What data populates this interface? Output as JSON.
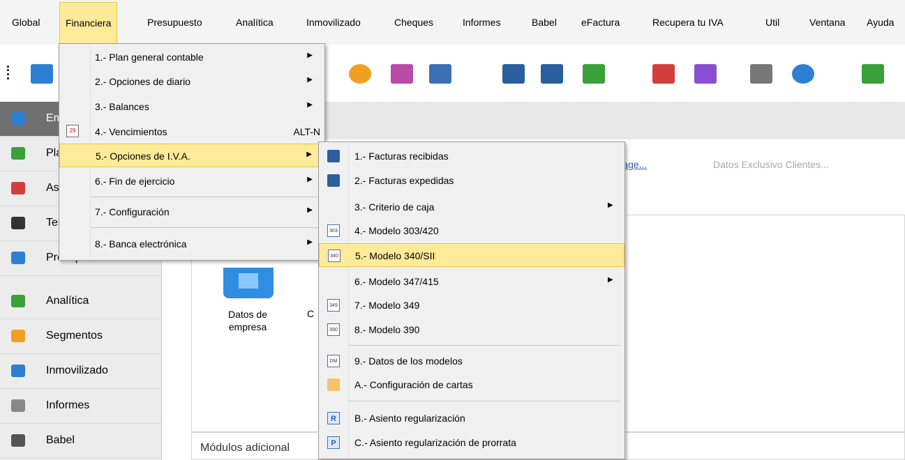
{
  "menubar": {
    "items": [
      {
        "label": "Global"
      },
      {
        "label": "Financiera"
      },
      {
        "label": "Presupuesto"
      },
      {
        "label": "Analítica"
      },
      {
        "label": "Inmovilizado"
      },
      {
        "label": "Cheques"
      },
      {
        "label": "Informes"
      },
      {
        "label": "Babel"
      },
      {
        "label": "eFactura"
      },
      {
        "label": "Recupera tu IVA"
      },
      {
        "label": "Util"
      },
      {
        "label": "Ventana"
      },
      {
        "label": "Ayuda"
      }
    ]
  },
  "toolbar": {
    "icons": [
      {
        "name": "company-icon",
        "color": "#2d7fd4"
      },
      {
        "name": "check-icon",
        "color": "#f0a020"
      },
      {
        "name": "cash-in-icon",
        "color": "#b84aa8"
      },
      {
        "name": "debit-icon",
        "color": "#3d6fb7"
      },
      {
        "name": "book-red-icon",
        "color": "#2a5f9e"
      },
      {
        "name": "book-green-icon",
        "color": "#2a5f9e"
      },
      {
        "name": "chart-icon",
        "color": "#3aa03a"
      },
      {
        "name": "cubes-icon",
        "color": "#d43d3d"
      },
      {
        "name": "segments-icon",
        "color": "#8a4fcf"
      },
      {
        "name": "frame-icon",
        "color": "#777777"
      },
      {
        "name": "search-add-icon",
        "color": "#2d7fd4"
      },
      {
        "name": "calendar-icon",
        "color": "#3aa03a"
      }
    ]
  },
  "sidebar": {
    "items": [
      {
        "label": "Empresa",
        "icon": "company-icon",
        "color": "#2d7fd4"
      },
      {
        "label": "Plan general",
        "icon": "plan-icon",
        "color": "#3aa03a"
      },
      {
        "label": "Asientos",
        "icon": "entries-icon",
        "color": "#d43d3d"
      },
      {
        "label": "Tesorería",
        "icon": "treasury-icon",
        "color": "#333333"
      },
      {
        "label": "Presupuestos",
        "icon": "budget-icon",
        "color": "#2d7fd4"
      },
      {
        "label": "Analítica",
        "icon": "analytics-icon",
        "color": "#3aa03a"
      },
      {
        "label": "Segmentos",
        "icon": "segments-icon",
        "color": "#f0a020"
      },
      {
        "label": "Inmovilizado",
        "icon": "fixed-assets-icon",
        "color": "#2d7fd4"
      },
      {
        "label": "Informes",
        "icon": "reports-icon",
        "color": "#888888"
      },
      {
        "label": "Babel",
        "icon": "babel-icon",
        "color": "#555555"
      }
    ]
  },
  "content": {
    "link": "Sage...",
    "note": "Datos Exclusivo Clientes...",
    "company_label": "Datos de empresa",
    "company_label2": "C",
    "modules_label": "Módulos adicional"
  },
  "menu1": {
    "items": [
      {
        "label": "1.- Plan general contable",
        "submenu": true
      },
      {
        "label": "2.- Opciones de diario",
        "submenu": true
      },
      {
        "label": "3.- Balances",
        "submenu": true
      },
      {
        "label": "4.- Vencimientos",
        "accel": "ALT-N",
        "icon": "calendar-icon"
      },
      {
        "label": "5.- Opciones de I.V.A.",
        "submenu": true,
        "highlighted": true
      },
      {
        "label": "6.- Fin de ejercicio",
        "submenu": true
      },
      {
        "label": "7.- Configuración",
        "submenu": true
      },
      {
        "label": "8.- Banca electrónica",
        "submenu": true
      }
    ]
  },
  "menu2": {
    "items": [
      {
        "label": "1.- Facturas recibidas",
        "icon": "book-red-icon"
      },
      {
        "label": "2.- Facturas expedidas",
        "icon": "book-green-icon"
      },
      {
        "label": "3.- Criterio de caja",
        "submenu": true
      },
      {
        "label": "4.- Modelo 303/420",
        "icon": "model-303-icon",
        "icon_text": "303"
      },
      {
        "label": "5.- Modelo 340/SII",
        "icon": "model-340-icon",
        "icon_text": "340",
        "highlighted": true
      },
      {
        "label": "6.- Modelo 347/415",
        "submenu": true
      },
      {
        "label": "7.- Modelo 349",
        "icon": "model-349-icon",
        "icon_text": "349"
      },
      {
        "label": "8.- Modelo 390",
        "icon": "model-390-icon",
        "icon_text": "390"
      },
      {
        "label": "9.- Datos de los modelos",
        "icon": "model-data-icon",
        "icon_text": "DM"
      },
      {
        "label": "A.- Configuración de cartas",
        "icon": "pencil-icon"
      },
      {
        "label": "B.- Asiento regularización",
        "icon": "regularization-icon",
        "icon_text": "R"
      },
      {
        "label": "C.- Asiento regularización de prorrata",
        "icon": "prorrata-icon",
        "icon_text": "P"
      }
    ]
  }
}
